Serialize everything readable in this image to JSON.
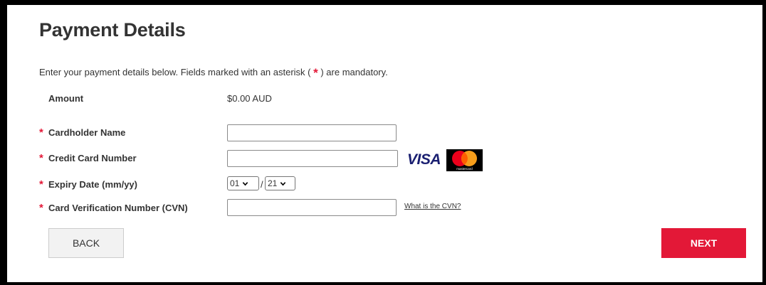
{
  "page": {
    "title": "Payment Details",
    "intro_before": "Enter your payment details below. Fields marked with an asterisk ( ",
    "intro_asterisk": "*",
    "intro_after": " ) are mandatory.",
    "required_marker": "*",
    "accent_color": "#e31837"
  },
  "amount": {
    "label": "Amount",
    "value": "$0.00 AUD"
  },
  "fields": {
    "cardholder_name": {
      "label": "Cardholder Name",
      "value": ""
    },
    "card_number": {
      "label": "Credit Card Number",
      "value": ""
    },
    "expiry": {
      "label": "Expiry Date (mm/yy)",
      "month": "01",
      "year": "21",
      "separator": "/"
    },
    "cvn": {
      "label": "Card Verification Number (CVN)",
      "value": "",
      "help_link": "What is the CVN?"
    }
  },
  "card_logos": {
    "visa": "VISA",
    "mastercard_wordmark": "mastercard"
  },
  "buttons": {
    "back": "BACK",
    "next": "NEXT"
  }
}
